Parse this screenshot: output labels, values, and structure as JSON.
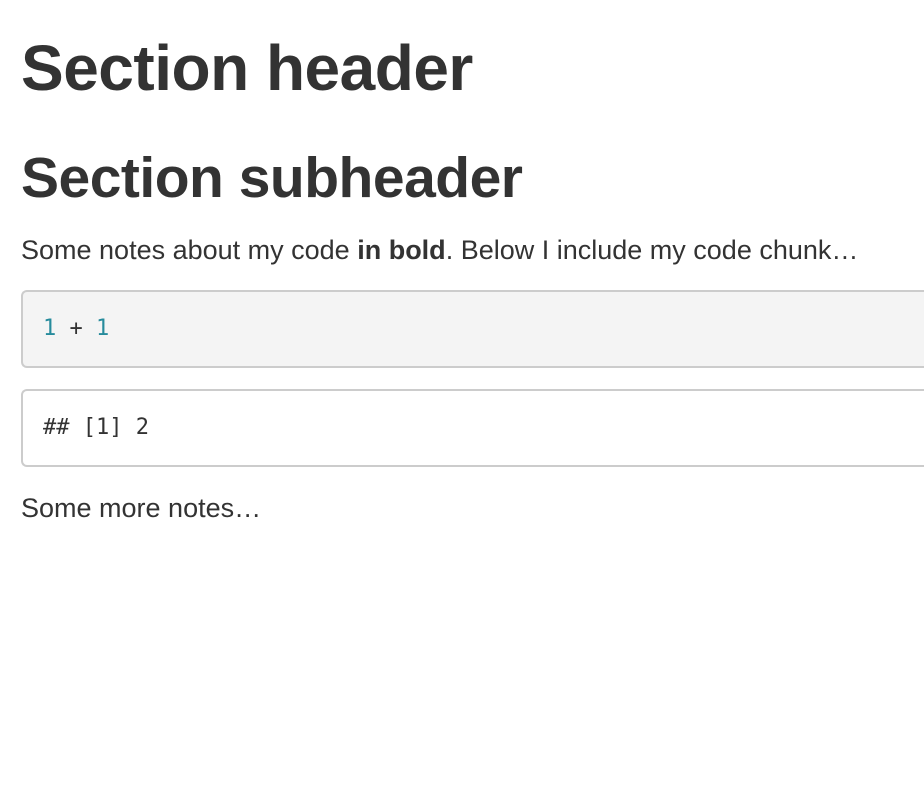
{
  "document": {
    "header": "Section header",
    "subheader": "Section subheader",
    "intro": {
      "before": "Some notes about my code ",
      "bold": "in bold",
      "after": ". Below I include my code chunk…"
    },
    "code_chunk": {
      "left_operand": "1",
      "operator": " + ",
      "right_operand": "1"
    },
    "output": "## [1] 2",
    "closing": "Some more notes…"
  },
  "colors": {
    "text": "#333333",
    "number": "#268b9c",
    "code_background": "#f4f4f4",
    "border": "#cccccc"
  }
}
